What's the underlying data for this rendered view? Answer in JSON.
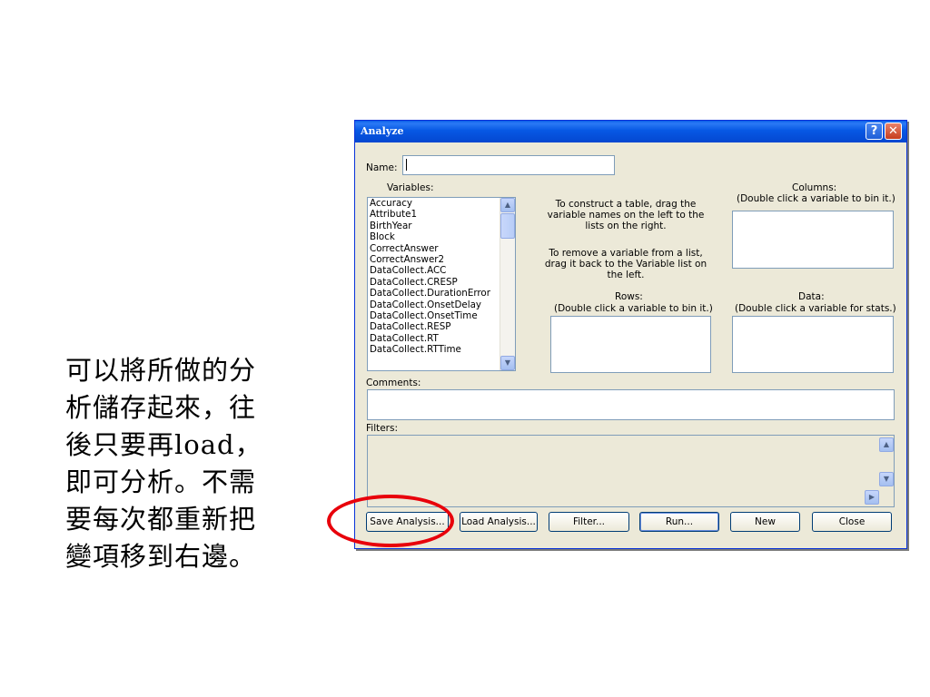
{
  "caption": {
    "lines": [
      "可以將所做的分",
      "析儲存起來，往",
      "後只要再load，",
      "即可分析。不需",
      "要每次都重新把",
      "變項移到右邊。"
    ]
  },
  "dialog": {
    "title": "Analyze",
    "help_glyph": "?",
    "close_glyph": "✕",
    "name_label": "Name:",
    "name_value": "",
    "variables_label": "Variables:",
    "variables": [
      "Accuracy",
      "Attribute1",
      "BirthYear",
      "Block",
      "CorrectAnswer",
      "CorrectAnswer2",
      "DataCollect.ACC",
      "DataCollect.CRESP",
      "DataCollect.DurationError",
      "DataCollect.OnsetDelay",
      "DataCollect.OnsetTime",
      "DataCollect.RESP",
      "DataCollect.RT",
      "DataCollect.RTTime"
    ],
    "instructions": {
      "construct": "To construct a table, drag the variable names on the left to the lists on the right.",
      "remove": "To remove a variable from a list, drag it back to the Variable list on the left."
    },
    "columns_label": "Columns:",
    "columns_hint": "(Double click a variable to bin it.)",
    "rows_label": "Rows:",
    "rows_hint": "(Double click a variable to bin it.)",
    "data_label": "Data:",
    "data_hint": "(Double click a variable for stats.)",
    "comments_label": "Comments:",
    "filters_label": "Filters:",
    "scroll_up_glyph": "▲",
    "scroll_down_glyph": "▼",
    "scroll_right_glyph": "▶",
    "buttons": {
      "save": "Save Analysis...",
      "load": "Load Analysis...",
      "filter": "Filter...",
      "run": "Run...",
      "new": "New",
      "close": "Close"
    }
  },
  "annotation": {
    "color": "#e8000b",
    "highlighted_button": "Save Analysis..."
  }
}
